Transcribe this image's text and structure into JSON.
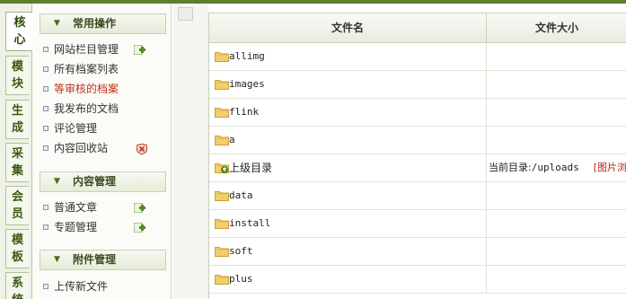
{
  "tabs": [
    {
      "label": "核心",
      "active": true
    },
    {
      "label": "模块"
    },
    {
      "label": "生成"
    },
    {
      "label": "采集"
    },
    {
      "label": "会员"
    },
    {
      "label": "模板"
    },
    {
      "label": "系统"
    }
  ],
  "sidebar": {
    "groups": [
      {
        "title": "常用操作",
        "items": [
          {
            "label": "网站栏目管理",
            "icon": "add-icon"
          },
          {
            "label": "所有档案列表"
          },
          {
            "label": "等审核的档案",
            "highlight": true
          },
          {
            "label": "我发布的文档"
          },
          {
            "label": "评论管理"
          },
          {
            "label": "内容回收站",
            "icon": "delete-icon"
          }
        ]
      },
      {
        "title": "内容管理",
        "items": [
          {
            "label": "普通文章",
            "icon": "add-icon"
          },
          {
            "label": "专题管理",
            "icon": "add-icon"
          }
        ]
      },
      {
        "title": "附件管理",
        "items": [
          {
            "label": "上传新文件"
          }
        ]
      }
    ]
  },
  "file_table": {
    "headers": {
      "name": "文件名",
      "size": "文件大小"
    },
    "rows": [
      {
        "name": "allimg",
        "icon": "folder-icon"
      },
      {
        "name": "images",
        "icon": "folder-icon"
      },
      {
        "name": "flink",
        "icon": "folder-icon"
      },
      {
        "name": "a",
        "icon": "folder-icon"
      },
      {
        "name": "上级目录",
        "icon": "up-folder-icon",
        "current_dir_label": "当前目录:",
        "current_dir_path": "/uploads",
        "images_link": "[图片浏览器]"
      },
      {
        "name": "data",
        "icon": "folder-icon"
      },
      {
        "name": "install",
        "icon": "folder-icon"
      },
      {
        "name": "soft",
        "icon": "folder-icon"
      },
      {
        "name": "plus",
        "icon": "folder-icon"
      }
    ]
  },
  "colors": {
    "brand_green": "#5f7f2e",
    "highlight_red": "#c0321a",
    "link_red": "#b3261e",
    "folder_yellow": "#f2cf6b"
  }
}
